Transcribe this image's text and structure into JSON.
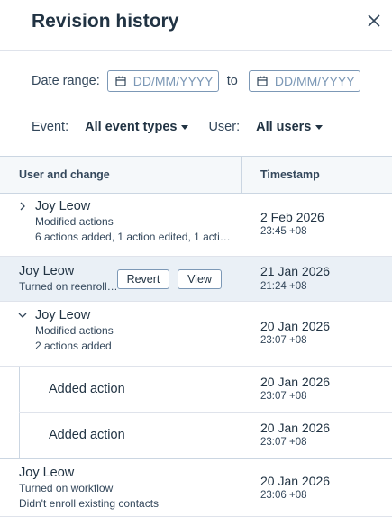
{
  "header": {
    "title": "Revision history",
    "close_icon": "close-icon"
  },
  "filters": {
    "date_range_label": "Date range:",
    "start_placeholder": "DD/MM/YYYY",
    "to_label": "to",
    "end_placeholder": "DD/MM/YYYY",
    "event_label": "Event:",
    "event_value": "All event types",
    "user_label": "User:",
    "user_value": "All users"
  },
  "table": {
    "columns": [
      "User and change",
      "Timestamp"
    ],
    "rows": [
      {
        "user": "Joy Leow",
        "line1": "Modified actions",
        "line2": "6 actions added, 1 action edited, 1 acti…",
        "date": "2 Feb 2026",
        "time": "23:45 +08",
        "expand": "chevron-right-icon"
      },
      {
        "user": "Joy Leow",
        "line1": "Turned on reenroll…",
        "date": "21 Jan 2026",
        "time": "21:24 +08",
        "revert_label": "Revert",
        "view_label": "View"
      },
      {
        "user": "Joy Leow",
        "line1": "Modified actions",
        "line2": "2 actions added",
        "date": "20 Jan 2026",
        "time": "23:07 +08",
        "expand": "chevron-down-icon"
      },
      {
        "user": "Added action",
        "date": "20 Jan 2026",
        "time": "23:07 +08"
      },
      {
        "user": "Added action",
        "date": "20 Jan 2026",
        "time": "23:07 +08"
      },
      {
        "user": "Joy Leow",
        "line1": "Turned on workflow",
        "line2": "Didn't enroll existing contacts",
        "date": "20 Jan 2026",
        "time": "23:06 +08"
      }
    ]
  }
}
